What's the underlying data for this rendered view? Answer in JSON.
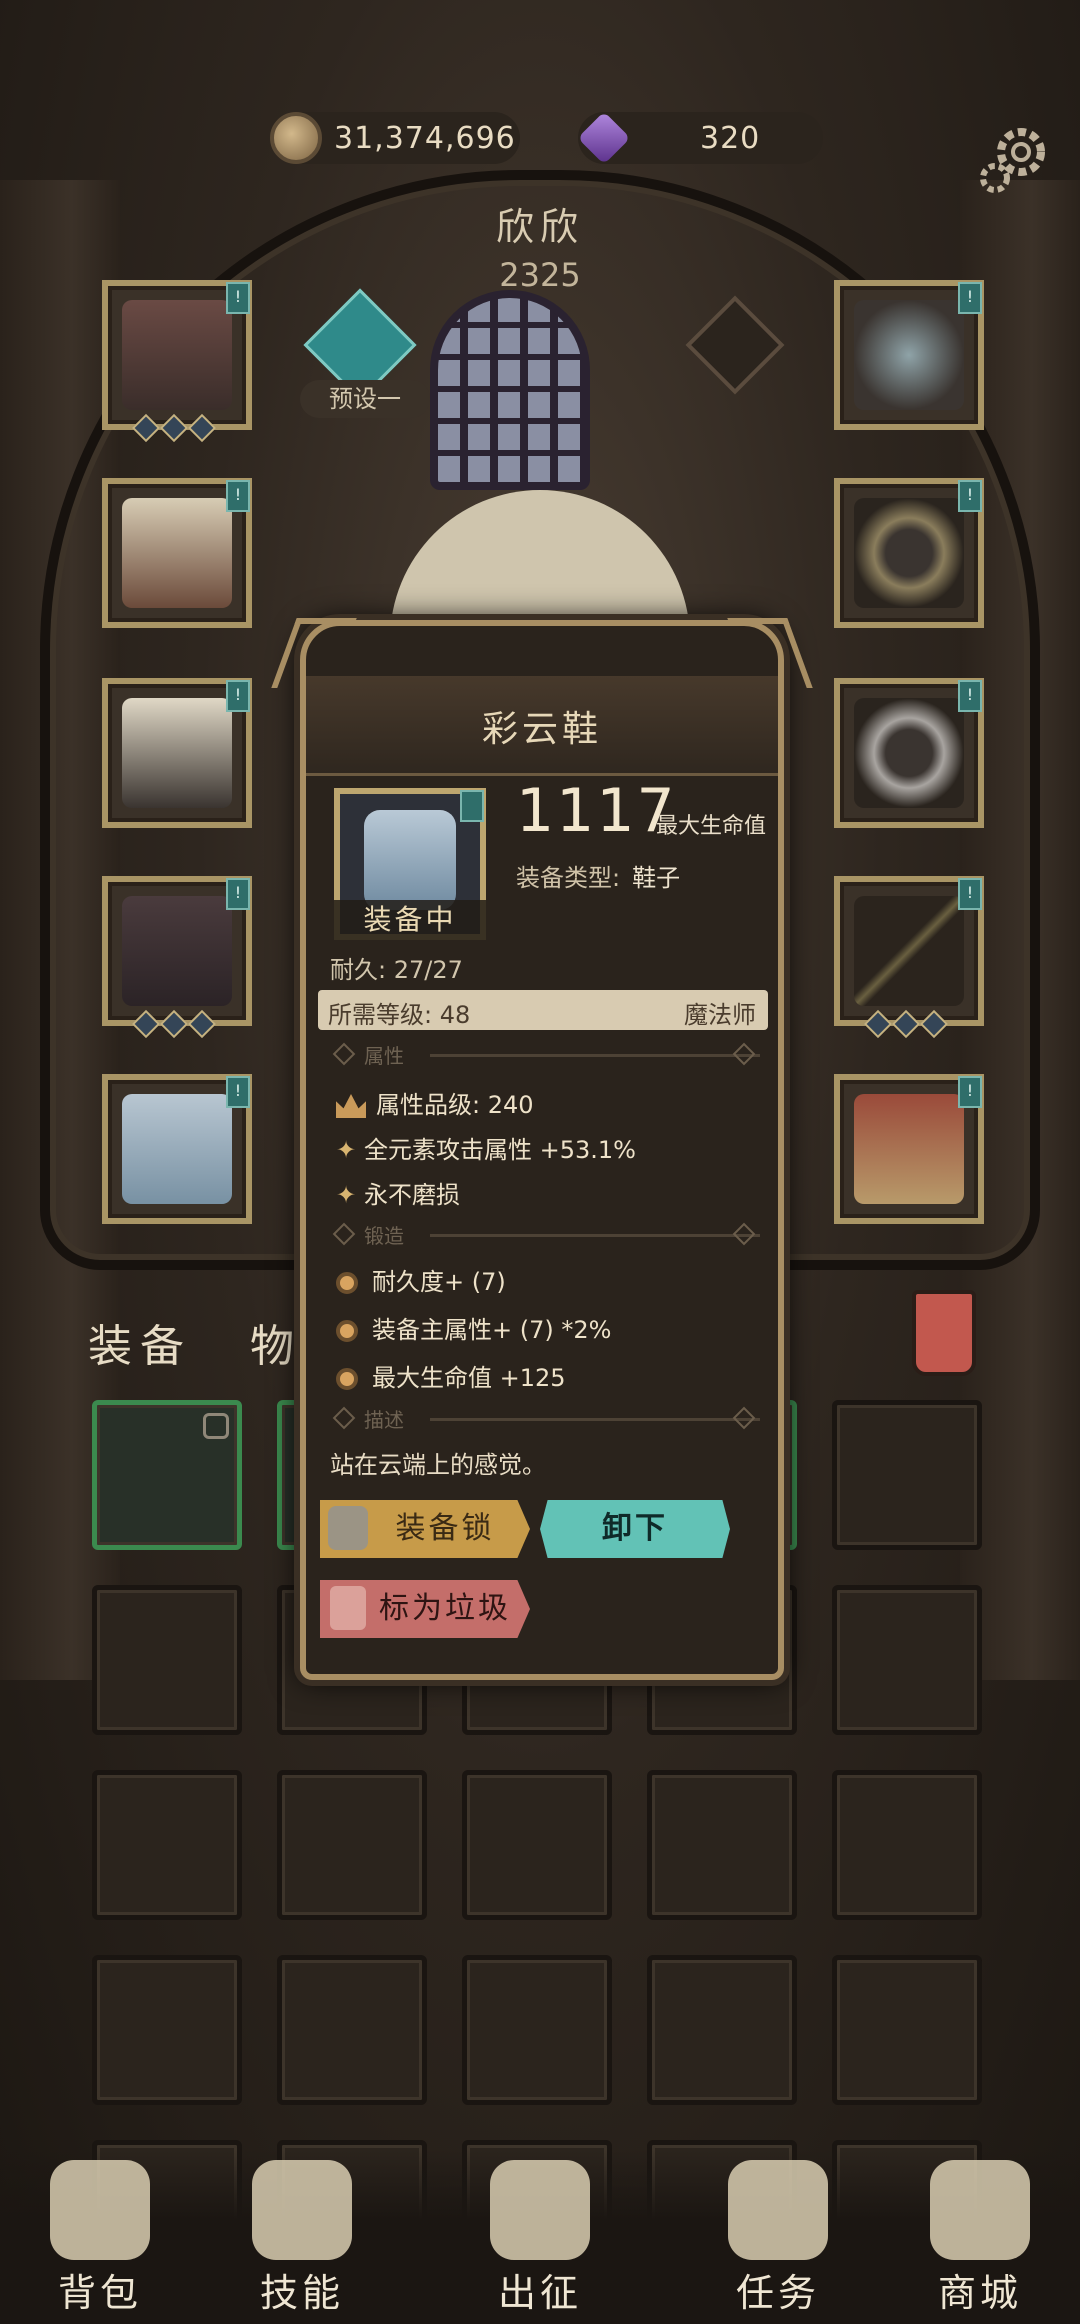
{
  "currencies": {
    "gold": "31,374,696",
    "gems": "320"
  },
  "character": {
    "name": "欣欣",
    "power": "2325",
    "preset_label": "预设一"
  },
  "tabs": {
    "equip": "装备",
    "items": "物品"
  },
  "popup": {
    "title": "彩云鞋",
    "equipped_label": "装备中",
    "main_value": "1117",
    "main_stat": "最大生命值",
    "type_label": "装备类型:",
    "type_value": "鞋子",
    "durability": "耐久: 27/27",
    "required_level": "所需等级: 48",
    "class": "魔法师",
    "sections": {
      "attributes": "属性",
      "forge": "锻造",
      "description": "描述"
    },
    "attributes": [
      "属性品级: 240",
      "全元素攻击属性 +53.1%",
      "永不磨损"
    ],
    "forge": [
      "耐久度+ (7)",
      "装备主属性+ (7) *2%",
      "最大生命值 +125"
    ],
    "description": "站在云端上的感觉。",
    "buttons": {
      "lock": "装备锁",
      "unequip": "卸下",
      "trash": "标为垃圾"
    }
  },
  "nav": [
    {
      "label": "背包"
    },
    {
      "label": "技能"
    },
    {
      "label": "出征"
    },
    {
      "label": "任务"
    },
    {
      "label": "商城"
    }
  ],
  "colors": {
    "background": "#2e261f",
    "slot_border": "#a99565",
    "popup_border": "#a88e63",
    "unequip_button": "#62c2b6",
    "lock_button": "#c79b49",
    "trash_button": "#c46e6a"
  }
}
